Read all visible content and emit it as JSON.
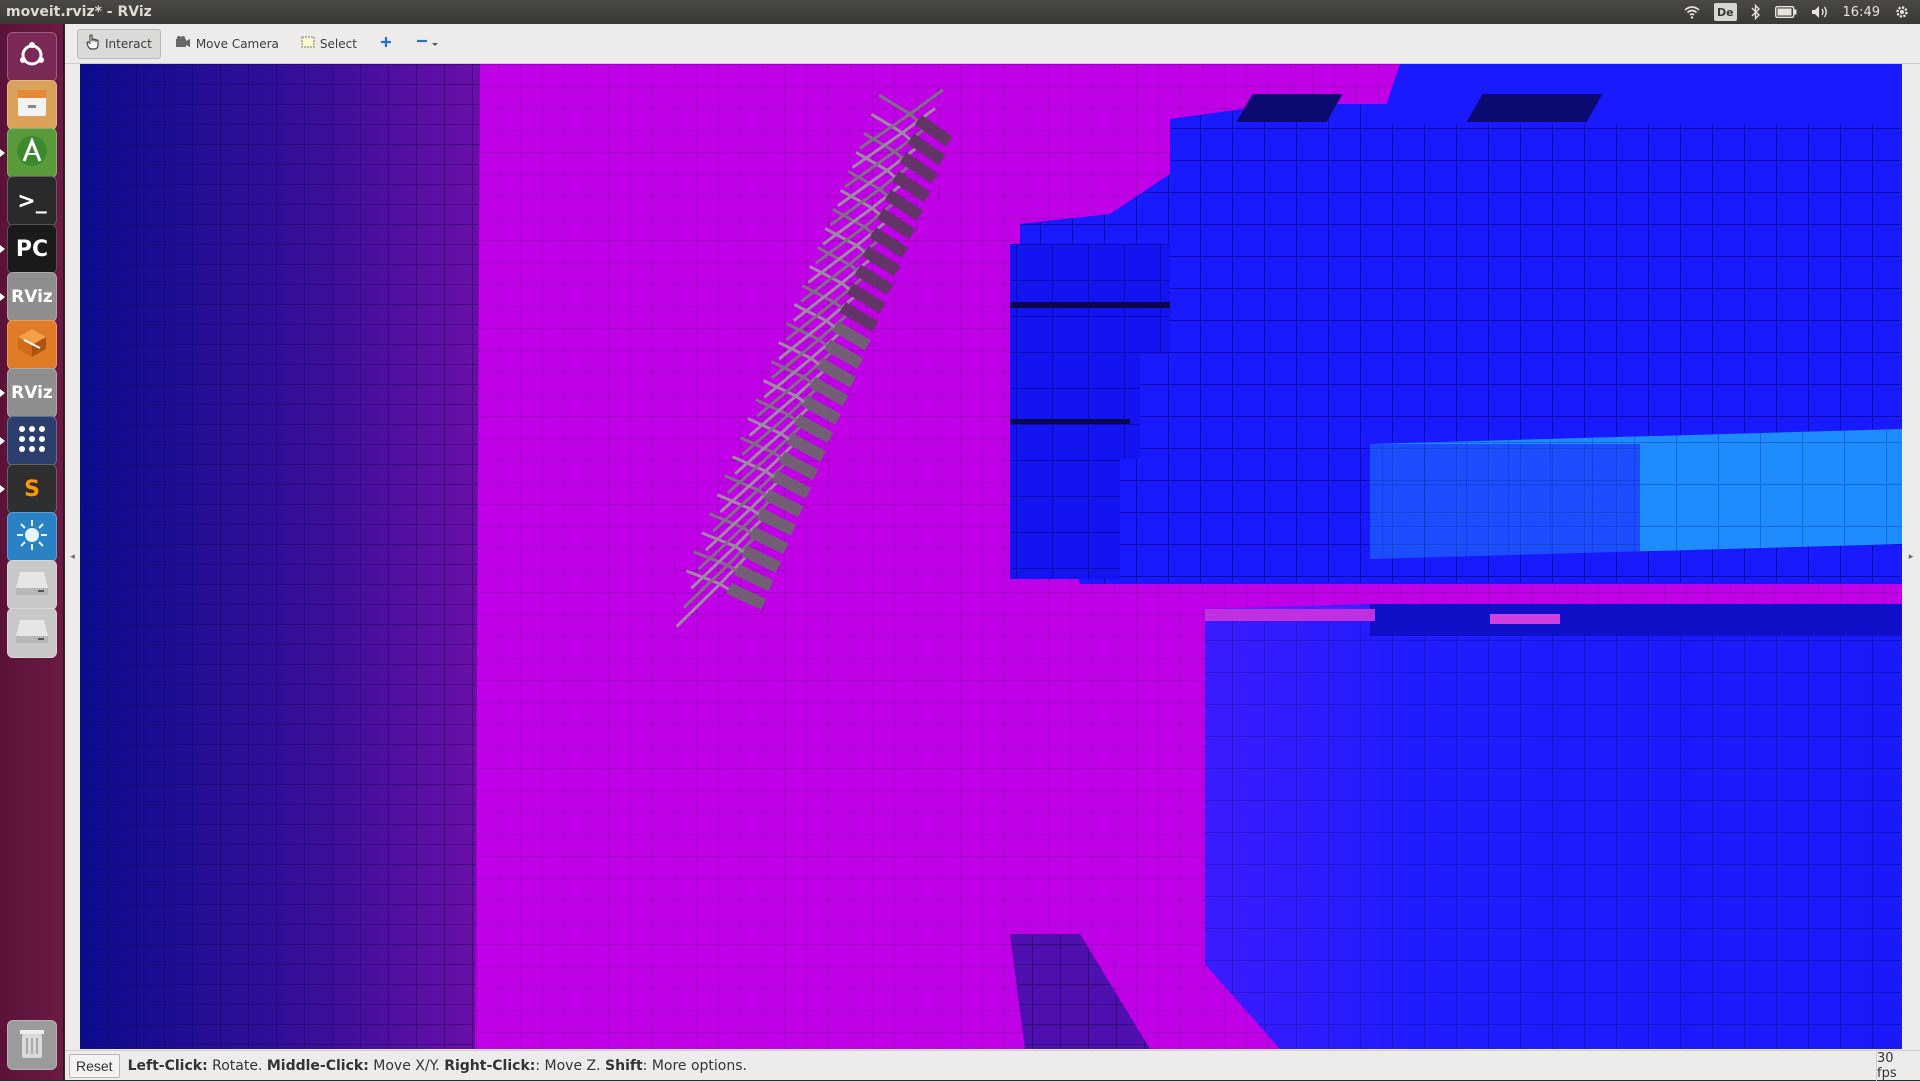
{
  "window": {
    "title": "moveit.rviz* - RViz"
  },
  "panel": {
    "keyboard_layout": "De",
    "clock": "16:49",
    "icons": [
      "wifi-icon",
      "keyboard-icon",
      "bluetooth-icon",
      "battery-icon",
      "volume-icon",
      "clock",
      "settings-gear-icon"
    ]
  },
  "launcher": {
    "items": [
      {
        "name": "ubuntu-dash",
        "icon": "ubuntu-logo-icon",
        "label": "",
        "color": "#7a2a55"
      },
      {
        "name": "files",
        "icon": "file-cabinet-icon",
        "label": "",
        "color": "#d9a15a"
      },
      {
        "name": "android-studio",
        "icon": "android-studio-icon",
        "label": "",
        "color": "#5a9a3a"
      },
      {
        "name": "terminal",
        "icon": "terminal-icon",
        "label": ">_",
        "color": "#2a2a2a"
      },
      {
        "name": "pycharm",
        "icon": "pycharm-icon",
        "label": "PC",
        "color": "#1a1a1a"
      },
      {
        "name": "rviz-1",
        "icon": "rviz-icon",
        "label": "RViz",
        "color": "#8e8e8e"
      },
      {
        "name": "blender-box",
        "icon": "box-3d-icon",
        "label": "",
        "color": "#e07b27"
      },
      {
        "name": "rviz-2",
        "icon": "rviz-icon",
        "label": "RViz",
        "color": "#8e8e8e"
      },
      {
        "name": "app-grid",
        "icon": "app-grid-icon",
        "label": "",
        "color": "#2c3e6b"
      },
      {
        "name": "sublime",
        "icon": "sublime-icon",
        "label": "S",
        "color": "#2f2f2f"
      },
      {
        "name": "gazebo",
        "icon": "sun-icon",
        "label": "",
        "color": "#2a82c4"
      },
      {
        "name": "drive-1",
        "icon": "drive-icon",
        "label": "",
        "color": "#c8c8c8"
      },
      {
        "name": "drive-2",
        "icon": "drive-icon",
        "label": "",
        "color": "#c8c8c8"
      },
      {
        "name": "trash",
        "icon": "trash-icon",
        "label": "",
        "color": "#9b9b9b"
      }
    ]
  },
  "toolbar": {
    "tools": [
      {
        "name": "interact",
        "label": "Interact",
        "icon": "hand-pointer-icon",
        "active": true
      },
      {
        "name": "move-camera",
        "label": "Move Camera",
        "icon": "move-camera-icon",
        "active": false
      },
      {
        "name": "select",
        "label": "Select",
        "icon": "select-rect-icon",
        "active": false
      },
      {
        "name": "add-tool",
        "label": "",
        "icon": "plus-icon",
        "active": false
      },
      {
        "name": "remove-tool",
        "label": "",
        "icon": "minus-dropdown-icon",
        "active": false
      }
    ]
  },
  "status": {
    "reset_label": "Reset",
    "help_parts": [
      {
        "bold": "Left-Click:",
        "text": " Rotate. "
      },
      {
        "bold": "Middle-Click:",
        "text": " Move X/Y. "
      },
      {
        "bold": "Right-Click:",
        "text": ": Move Z. "
      },
      {
        "bold": "Shift",
        "text": ": More options."
      }
    ],
    "fps": "30 fps"
  },
  "colors": {
    "background_magenta": "#c000e6",
    "voxel_blue": "#1a1aff",
    "voxel_light_blue": "#1ea0ff",
    "wall_dark": "#1a0b70",
    "robot_gray": "#8a8a8a"
  }
}
